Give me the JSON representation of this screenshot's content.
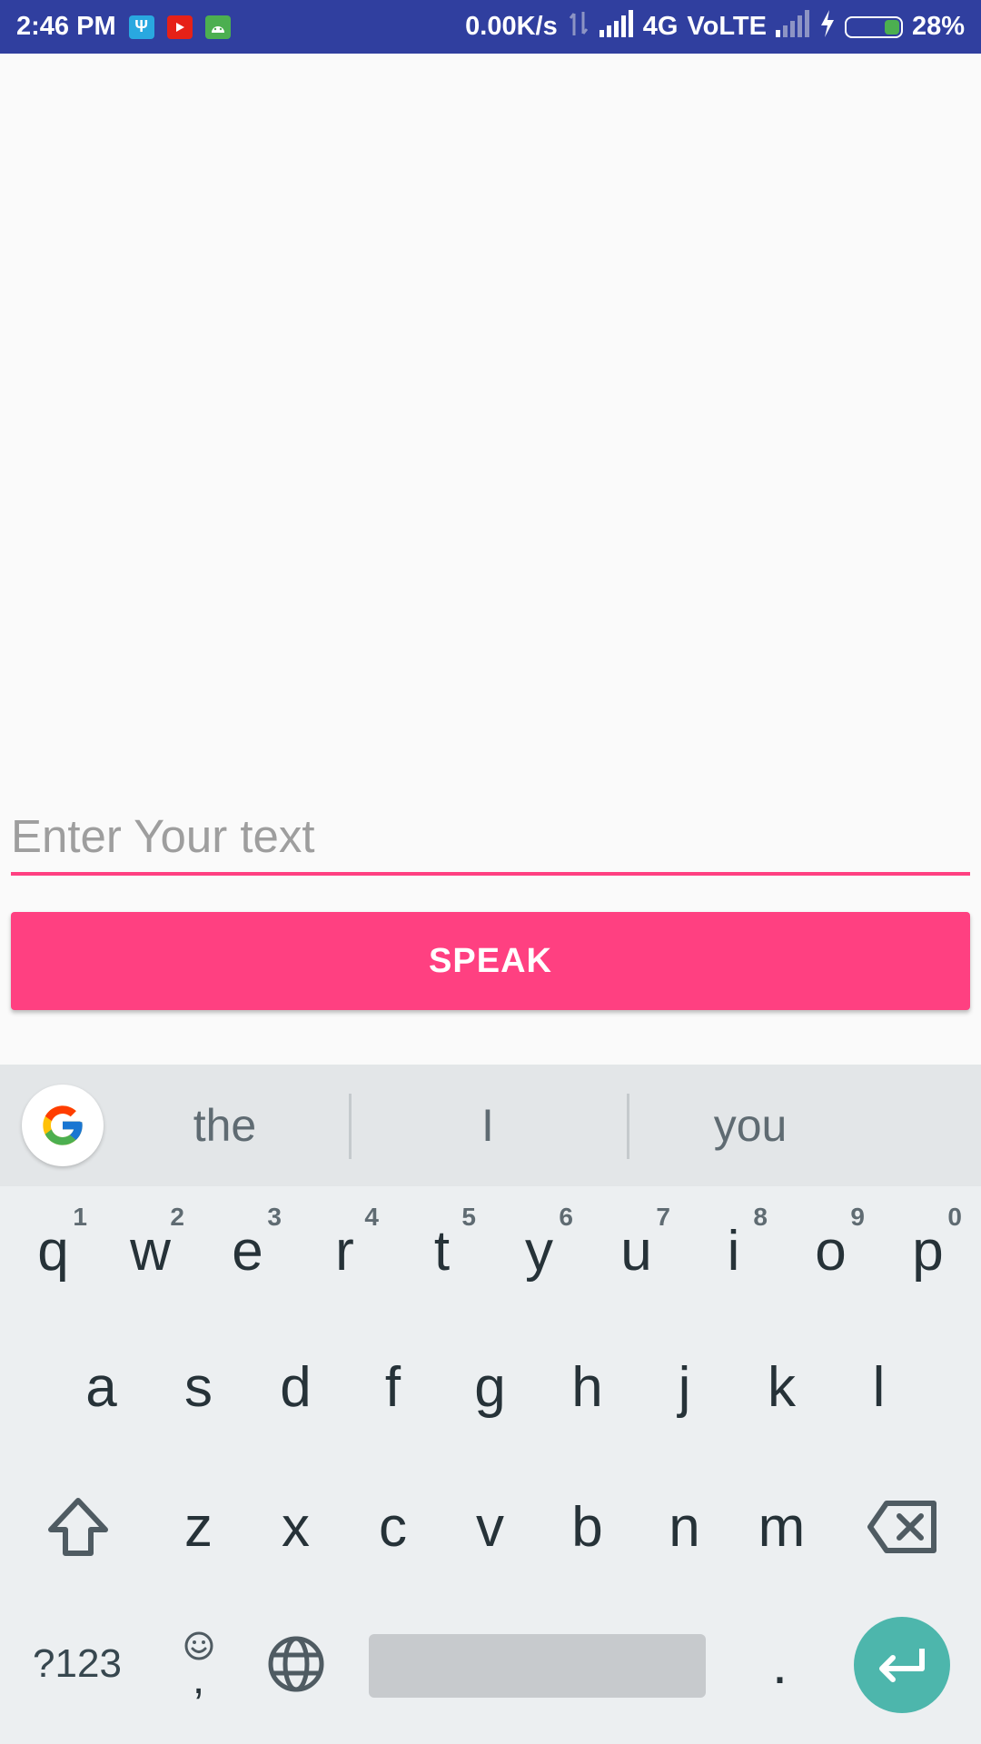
{
  "status_bar": {
    "time": "2:46 PM",
    "net_speed": "0.00K/s",
    "network_type": "4G",
    "volte": "VoLTE",
    "battery_percent": "28%",
    "battery_level": 0.28,
    "notification_icons": [
      "usb-icon",
      "youtube-icon",
      "android-icon"
    ]
  },
  "main": {
    "text_input": {
      "placeholder": "Enter Your text",
      "value": ""
    },
    "speak_button": "SPEAK",
    "accent_color": "#ff4081"
  },
  "keyboard": {
    "suggestions": [
      "the",
      "I",
      "you"
    ],
    "row1": [
      {
        "label": "q",
        "hint": "1"
      },
      {
        "label": "w",
        "hint": "2"
      },
      {
        "label": "e",
        "hint": "3"
      },
      {
        "label": "r",
        "hint": "4"
      },
      {
        "label": "t",
        "hint": "5"
      },
      {
        "label": "y",
        "hint": "6"
      },
      {
        "label": "u",
        "hint": "7"
      },
      {
        "label": "i",
        "hint": "8"
      },
      {
        "label": "o",
        "hint": "9"
      },
      {
        "label": "p",
        "hint": "0"
      }
    ],
    "row2": [
      "a",
      "s",
      "d",
      "f",
      "g",
      "h",
      "j",
      "k",
      "l"
    ],
    "row3": [
      "z",
      "x",
      "c",
      "v",
      "b",
      "n",
      "m"
    ],
    "symbols_key": "?123",
    "comma_key": ",",
    "period_key": ".",
    "enter_color": "#4db6ac"
  }
}
